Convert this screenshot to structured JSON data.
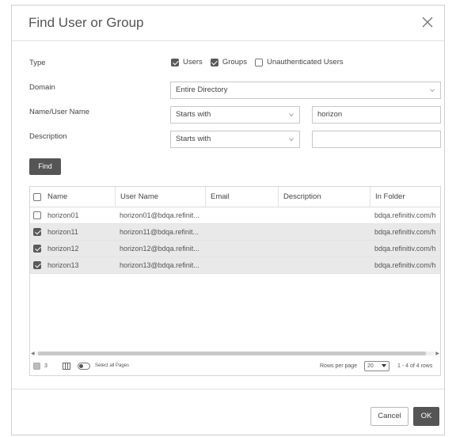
{
  "dialog": {
    "title": "Find User or Group",
    "close_icon": "close-icon"
  },
  "form": {
    "type_label": "Type",
    "type_options": [
      {
        "label": "Users",
        "checked": true
      },
      {
        "label": "Groups",
        "checked": true
      },
      {
        "label": "Unauthenticated Users",
        "checked": false
      }
    ],
    "domain_label": "Domain",
    "domain_value": "Entire Directory",
    "name_label": "Name/User Name",
    "name_match": "Starts with",
    "name_value": "horizon",
    "description_label": "Description",
    "description_match": "Starts with",
    "description_value": "",
    "find_label": "Find"
  },
  "grid": {
    "columns": [
      "Name",
      "User Name",
      "Email",
      "Description",
      "In Folder"
    ],
    "rows": [
      {
        "name": "horizon01",
        "user_name": "horizon01@bdqa.refinit...",
        "email": "",
        "description": "",
        "folder": "bdqa.refinitiv.com/h",
        "selected": false
      },
      {
        "name": "horizon11",
        "user_name": "horizon11@bdqa.refinit...",
        "email": "",
        "description": "",
        "folder": "bdqa.refinitiv.com/h",
        "selected": true
      },
      {
        "name": "horizon12",
        "user_name": "horizon12@bdqa.refinit...",
        "email": "",
        "description": "",
        "folder": "bdqa.refinitiv.com/h",
        "selected": true
      },
      {
        "name": "horizon13",
        "user_name": "horizon13@bdqa.refinit...",
        "email": "",
        "description": "",
        "folder": "bdqa.refinitiv.com/h",
        "selected": true
      }
    ],
    "footer": {
      "selected_count": "3",
      "select_all_pages": "Select all Pages",
      "rows_per_page_label": "Rows per page",
      "rows_per_page_value": "20",
      "range": "1 - 4 of 4 rows"
    }
  },
  "buttons": {
    "cancel": "Cancel",
    "ok": "OK"
  },
  "colors": {
    "primary_button": "#555555",
    "selected_row": "#e9e9e9"
  }
}
